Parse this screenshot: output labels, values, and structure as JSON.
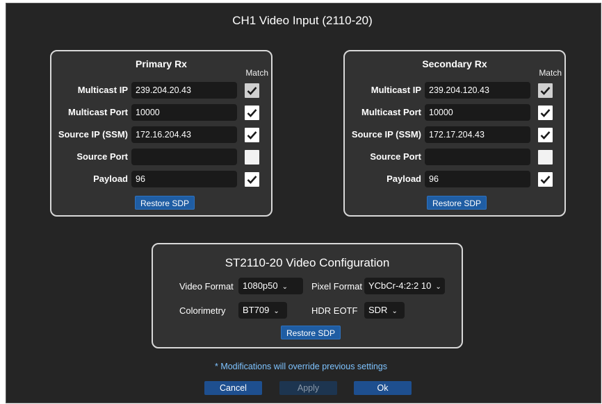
{
  "dialog": {
    "title": "CH1 Video Input (2110-20)"
  },
  "primary": {
    "title": "Primary Rx",
    "match_label": "Match",
    "fields": [
      {
        "label": "Multicast IP",
        "value": "239.204.20.43",
        "match": true
      },
      {
        "label": "Multicast Port",
        "value": "10000",
        "match": true
      },
      {
        "label": "Source IP (SSM)",
        "value": "172.16.204.43",
        "match": true
      },
      {
        "label": "Source Port",
        "value": "",
        "match": false
      },
      {
        "label": "Payload",
        "value": "96",
        "match": true
      }
    ],
    "restore_label": "Restore SDP"
  },
  "secondary": {
    "title": "Secondary Rx",
    "match_label": "Match",
    "fields": [
      {
        "label": "Multicast IP",
        "value": "239.204.120.43",
        "match": true
      },
      {
        "label": "Multicast Port",
        "value": "10000",
        "match": true
      },
      {
        "label": "Source IP (SSM)",
        "value": "172.17.204.43",
        "match": true
      },
      {
        "label": "Source Port",
        "value": "",
        "match": false
      },
      {
        "label": "Payload",
        "value": "96",
        "match": true
      }
    ],
    "restore_label": "Restore SDP"
  },
  "config": {
    "title": "ST2110-20 Video Configuration",
    "video_format_label": "Video Format",
    "video_format_value": "1080p50",
    "pixel_format_label": "Pixel Format",
    "pixel_format_value": "YCbCr-4:2:2 10",
    "colorimetry_label": "Colorimetry",
    "colorimetry_value": "BT709",
    "hdr_label": "HDR EOTF",
    "hdr_value": "SDR",
    "restore_label": "Restore SDP"
  },
  "note": "* Modifications will override previous settings",
  "buttons": {
    "cancel": "Cancel",
    "apply": "Apply",
    "ok": "Ok"
  },
  "colors": {
    "accent": "#1e4f8f",
    "note": "#7ec3ff",
    "panel_border": "#d9d9d9"
  }
}
